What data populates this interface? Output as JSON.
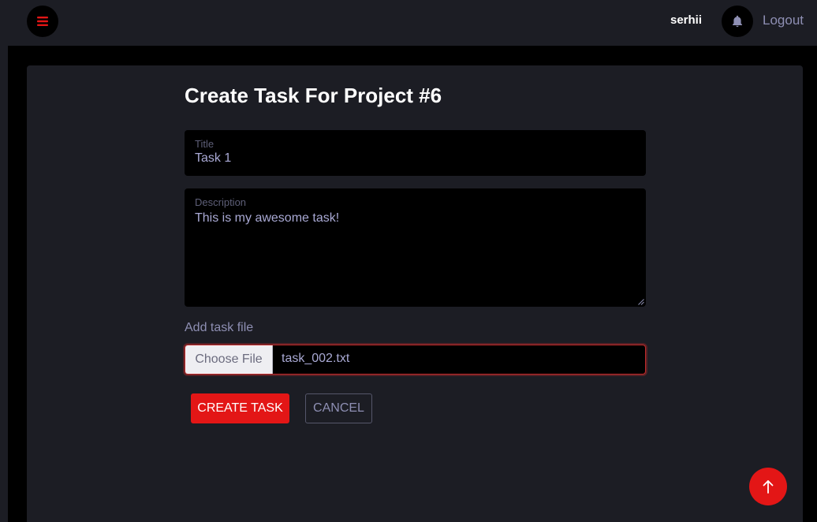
{
  "header": {
    "menu_icon": "hamburger-menu-icon",
    "username": "serhii",
    "notification_icon": "bell-icon",
    "logout_label": "Logout"
  },
  "form": {
    "title": "Create Task For Project #6",
    "title_field": {
      "label": "Title",
      "value": "Task 1"
    },
    "description_field": {
      "label": "Description",
      "value": "This is my awesome task!"
    },
    "file_field": {
      "label": "Add task file",
      "button_label": "Choose File",
      "file_name": "task_002.txt"
    },
    "create_button_label": "CREATE TASK",
    "cancel_button_label": "CANCEL"
  },
  "scroll_top_icon": "arrow-up-icon",
  "colors": {
    "accent": "#e31616",
    "background": "#1c1d24",
    "field_background": "#000000",
    "muted_text": "#8e8fb3"
  }
}
